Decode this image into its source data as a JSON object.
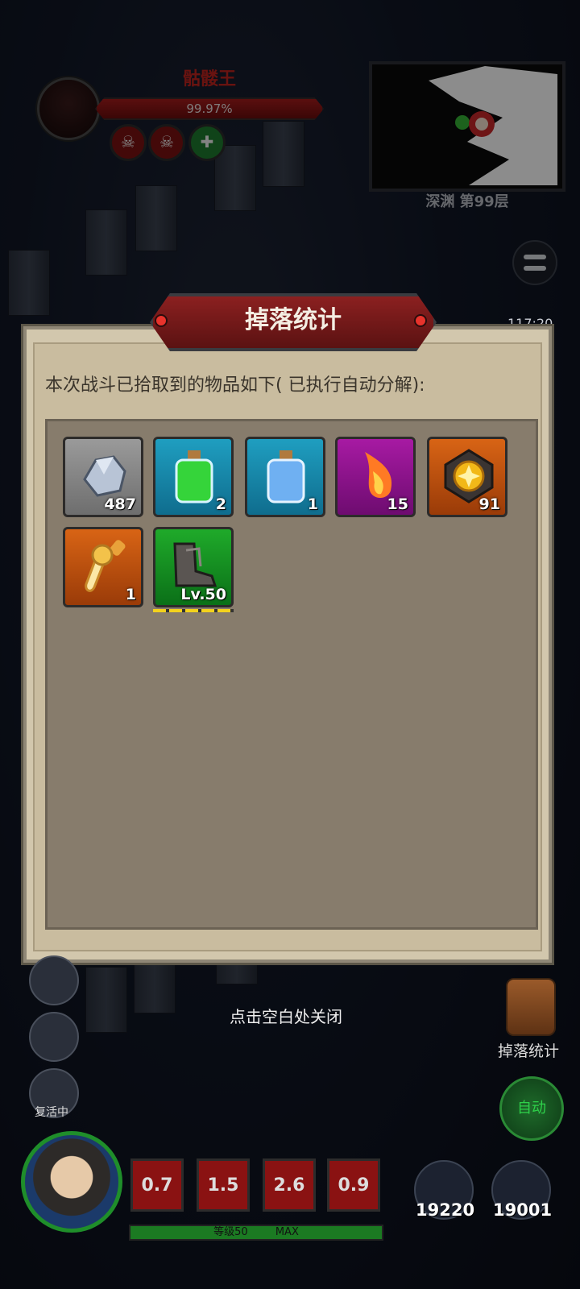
{
  "boss": {
    "name": "骷髅王",
    "hp_text": "99.97%",
    "hp_fraction": 0.9997
  },
  "map": {
    "label": "深渊 第99层"
  },
  "timer": "117:20",
  "modal": {
    "title": "掉落统计",
    "description": "本次战斗已拾取到的物品如下( 已执行自动分解):",
    "items": [
      {
        "name": "stone-ore-icon",
        "count": "487",
        "rarity": "gray"
      },
      {
        "name": "green-potion-icon",
        "count": "2",
        "rarity": "blue"
      },
      {
        "name": "blue-potion-icon",
        "count": "1",
        "rarity": "blue"
      },
      {
        "name": "flame-crystal-icon",
        "count": "15",
        "rarity": "purple"
      },
      {
        "name": "gold-emblem-icon",
        "count": "91",
        "rarity": "orange"
      },
      {
        "name": "cute-sword-icon",
        "count": "1",
        "rarity": "orange"
      },
      {
        "name": "armored-boots-icon",
        "count": "Lv.50",
        "rarity": "green"
      }
    ]
  },
  "close_hint": "点击空白处关闭",
  "hud": {
    "revive_label": "复活中",
    "skills": [
      "0.7",
      "1.5",
      "2.6",
      "0.9"
    ],
    "level_text": "等级50",
    "max_text": "MAX",
    "blue_potion_count": "19220",
    "green_potion_count": "19001",
    "bag_label": "掉落统计",
    "auto_label": "自动"
  }
}
